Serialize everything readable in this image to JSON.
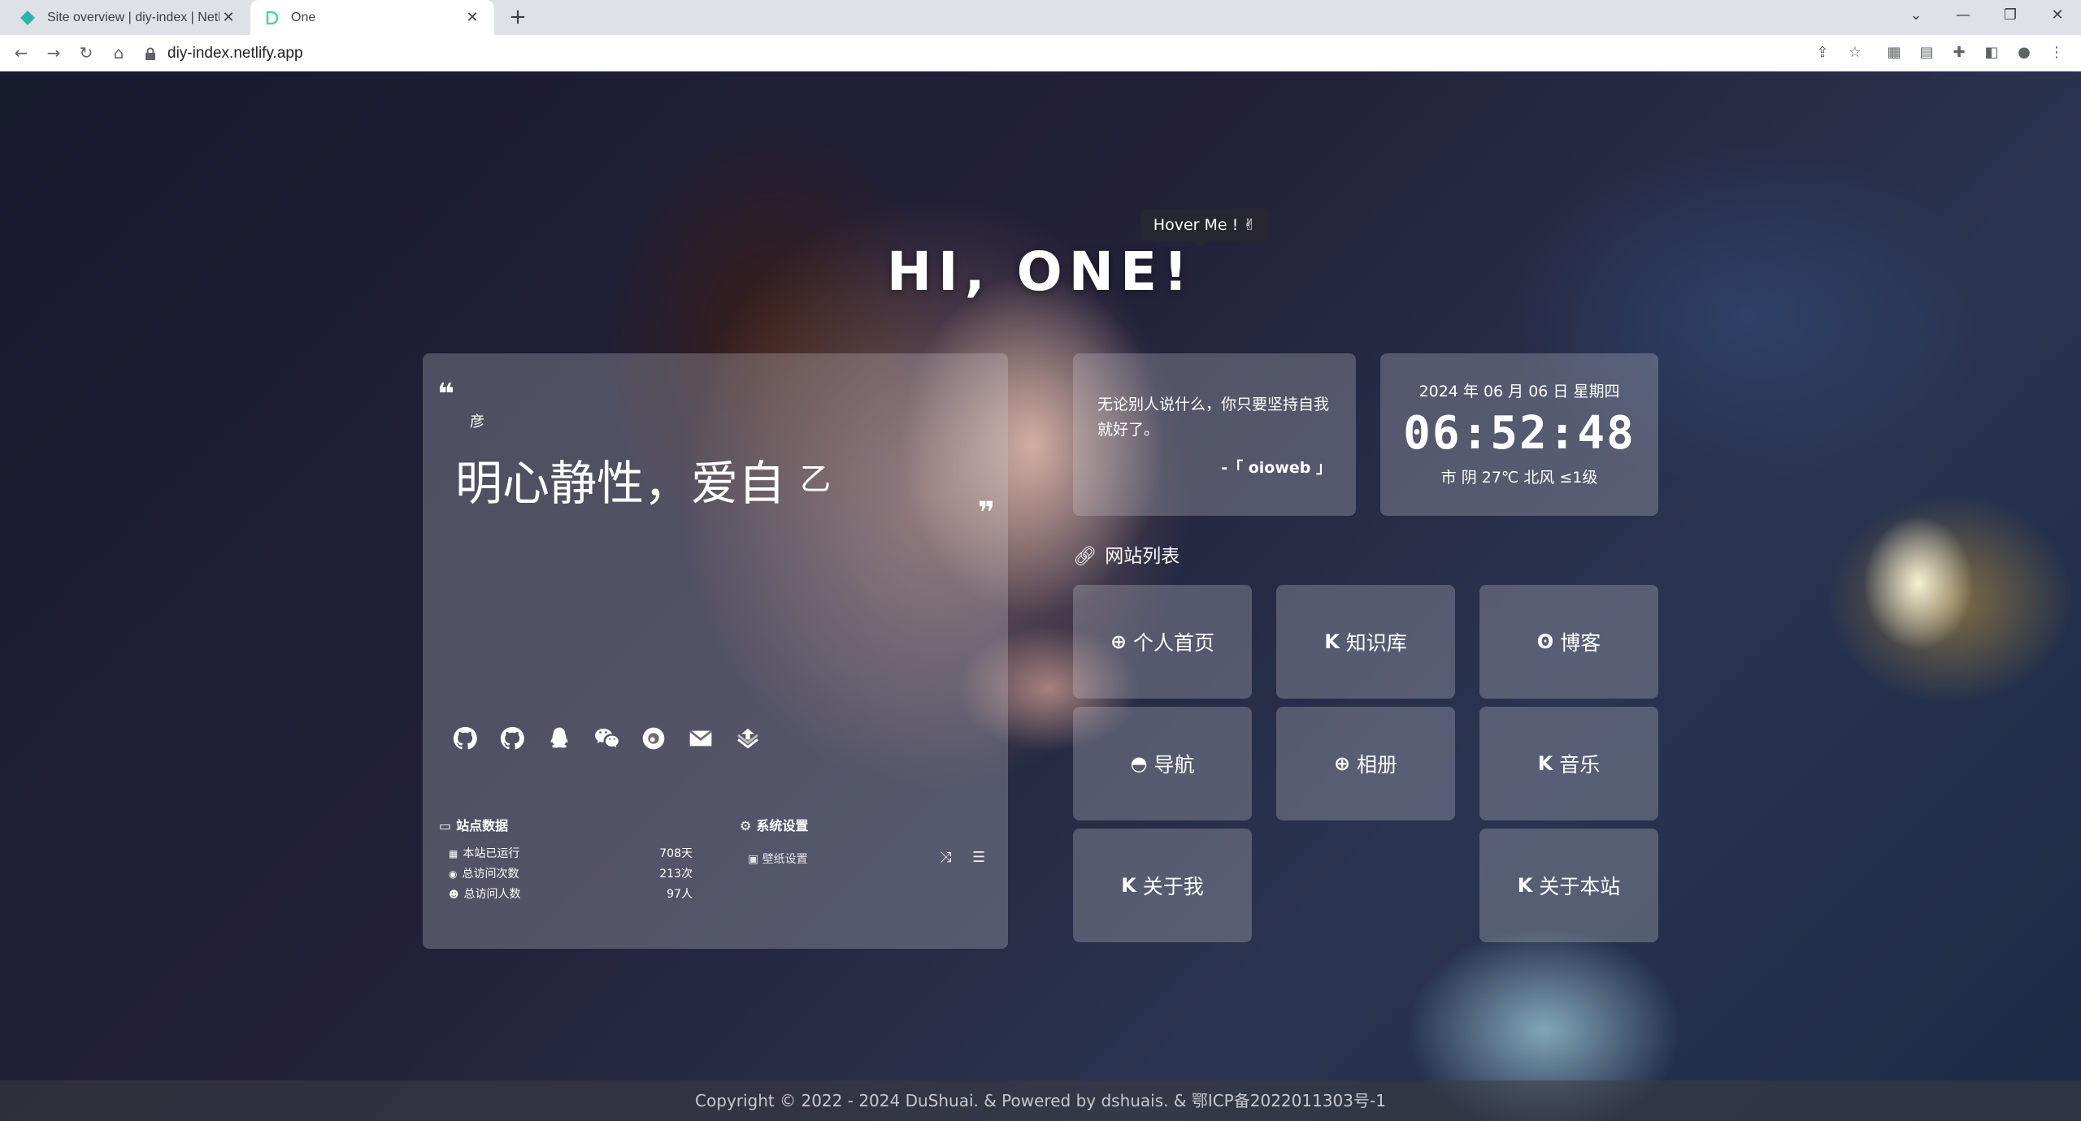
{
  "browser": {
    "tabs": [
      {
        "title": "Site overview | diy-index | Netl",
        "active": false
      },
      {
        "title": "One",
        "active": true
      }
    ],
    "url": "diy-index.netlify.app"
  },
  "page": {
    "hover_tip": "Hover Me ! ✌",
    "hello": "HI, ONE!",
    "left_card": {
      "quote_open": "❝",
      "quote_sub": "彦",
      "motto": "明心静性，爱自",
      "motto_cursor": "乙",
      "quote_close": "❞",
      "social_icons": [
        "github-icon",
        "github-icon",
        "qq-icon",
        "wechat-icon",
        "weibo-icon",
        "email-icon",
        "download-icon"
      ],
      "stats": {
        "title": "站点数据",
        "rows": [
          {
            "label": "本站已运行",
            "value": "708天"
          },
          {
            "label": "总访问次数",
            "value": "213次"
          },
          {
            "label": "总访问人数",
            "value": "97人"
          }
        ]
      },
      "settings": {
        "title": "系统设置",
        "wallpaper_label": "壁纸设置"
      }
    },
    "quote_card": {
      "text": "无论别人说什么，你只要坚持自我就好了。",
      "from": "-「 oioweb 」"
    },
    "time_card": {
      "date": "2024 年 06 月 06 日 星期四",
      "time": "06:52:48",
      "weather": "市 阴 27℃ 北风 ≤1级"
    },
    "sites": {
      "title": "网站列表",
      "items": [
        {
          "label": "个人首页",
          "icon": "globe-icon"
        },
        {
          "label": "知识库",
          "icon": "k-icon"
        },
        {
          "label": "博客",
          "icon": "blog-icon"
        },
        {
          "label": "导航",
          "icon": "compass-icon"
        },
        {
          "label": "相册",
          "icon": "globe-icon"
        },
        {
          "label": "音乐",
          "icon": "k-icon"
        },
        {
          "label": "关于我",
          "icon": "k-icon"
        },
        {
          "label": "关于本站",
          "icon": "k-icon"
        }
      ]
    },
    "footer": "Copyright © 2022 - 2024 DuShuai.  &  Powered by dshuais.  &  鄂ICP备2022011303号-1"
  }
}
